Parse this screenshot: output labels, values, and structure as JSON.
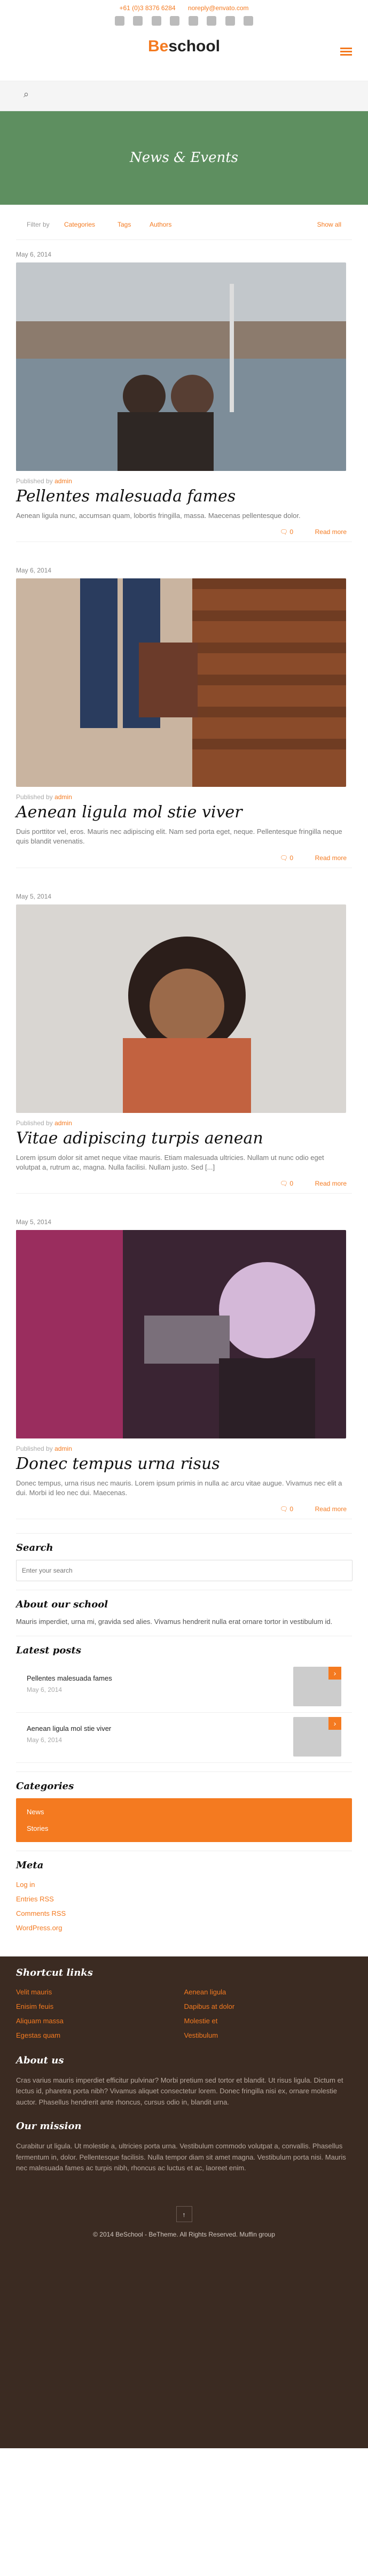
{
  "header": {
    "phone": "+61 (0)3 8376 6284",
    "email": "noreply@envato.com",
    "logo_be": "Be",
    "logo_name": "school",
    "menu_icon": "hamburger-icon"
  },
  "search": {
    "icon": "search-icon"
  },
  "hero": {
    "title": "News & Events"
  },
  "filters": {
    "label": "Filter by",
    "categories": "Categories",
    "tags": "Tags",
    "authors": "Authors",
    "show_all": "Show all"
  },
  "posts": [
    {
      "date": "May 6, 2014",
      "author_prefix": "Published by",
      "author": "admin",
      "title": "Pellentes malesuada fames",
      "excerpt": "Aenean ligula nunc, accumsan quam, lobortis fringilla, massa. Maecenas pellentesque dolor.",
      "comments": "0",
      "read_more": "Read more"
    },
    {
      "date": "May 6, 2014",
      "author_prefix": "Published by",
      "author": "admin",
      "title": "Aenean ligula mol stie viver",
      "excerpt": "Duis porttitor vel, eros. Mauris nec adipiscing elit. Nam sed porta eget, neque. Pellentesque fringilla neque quis blandit venenatis.",
      "comments": "0",
      "read_more": "Read more"
    },
    {
      "date": "May 5, 2014",
      "author_prefix": "Published by",
      "author": "admin",
      "title": "Vitae adipiscing turpis aenean",
      "excerpt": "Lorem ipsum dolor sit amet neque vitae mauris. Etiam malesuada ultricies. Nullam ut nunc odio eget volutpat a, rutrum ac, magna. Nulla facilisi. Nullam justo. Sed [...]",
      "comments": "0",
      "read_more": "Read more"
    },
    {
      "date": "May 5, 2014",
      "author_prefix": "Published by",
      "author": "admin",
      "title": "Donec tempus urna risus",
      "excerpt": "Donec tempus, urna risus nec mauris. Lorem ipsum primis in nulla ac arcu vitae augue. Vivamus nec elit a dui. Morbi id leo nec dui. Maecenas.",
      "comments": "0",
      "read_more": "Read more"
    }
  ],
  "sidebar": {
    "search_title": "Search",
    "search_placeholder": "Enter your search",
    "about_title": "About our school",
    "about_text": "Mauris imperdiet, urna mi, gravida sed alies. Vivamus hendrerit nulla erat ornare tortor in vestibulum id.",
    "latest_title": "Latest posts",
    "latest": [
      {
        "title": "Pellentes malesuada fames",
        "date": "May 6, 2014"
      },
      {
        "title": "Aenean ligula mol stie viver",
        "date": "May 6, 2014"
      }
    ],
    "categories_title": "Categories",
    "categories": [
      "News",
      "Stories"
    ],
    "meta_title": "Meta",
    "meta": [
      "Log in",
      "Entries RSS",
      "Comments RSS",
      "WordPress.org"
    ]
  },
  "footer": {
    "shortcut_title": "Shortcut links",
    "links_left": [
      "Velit mauris",
      "Enisim feuis",
      "Aliquam massa",
      "Egestas quam"
    ],
    "links_right": [
      "Aenean ligula",
      "Dapibus at dolor",
      "Molestie et",
      "Vestibulum"
    ],
    "about_title": "About us",
    "about_text": "Cras varius mauris imperdiet efficitur pulvinar? Morbi pretium sed tortor et blandit. Ut risus ligula. Dictum et lectus id, pharetra porta nibh? Vivamus aliquet consectetur lorem. Donec fringilla nisi ex, ornare molestie auctor. Phasellus hendrerit ante rhoncus, cursus odio in, blandit urna.",
    "mission_title": "Our mission",
    "mission_text": "Curabitur ut ligula. Ut molestie a, ultricies porta urna. Vestibulum commodo volutpat a, convallis. Phasellus fermentum in, dolor. Pellentesque facilisis. Nulla tempor diam sit amet magna. Vestibulum porta nisi. Mauris nec malesuada fames ac turpis nibh, rhoncus ac luctus et ac, laoreet enim.",
    "copyright": "© 2014 BeSchool - BeTheme. All Rights Reserved. Muffin group",
    "back_top_icon": "arrow-up-icon"
  }
}
